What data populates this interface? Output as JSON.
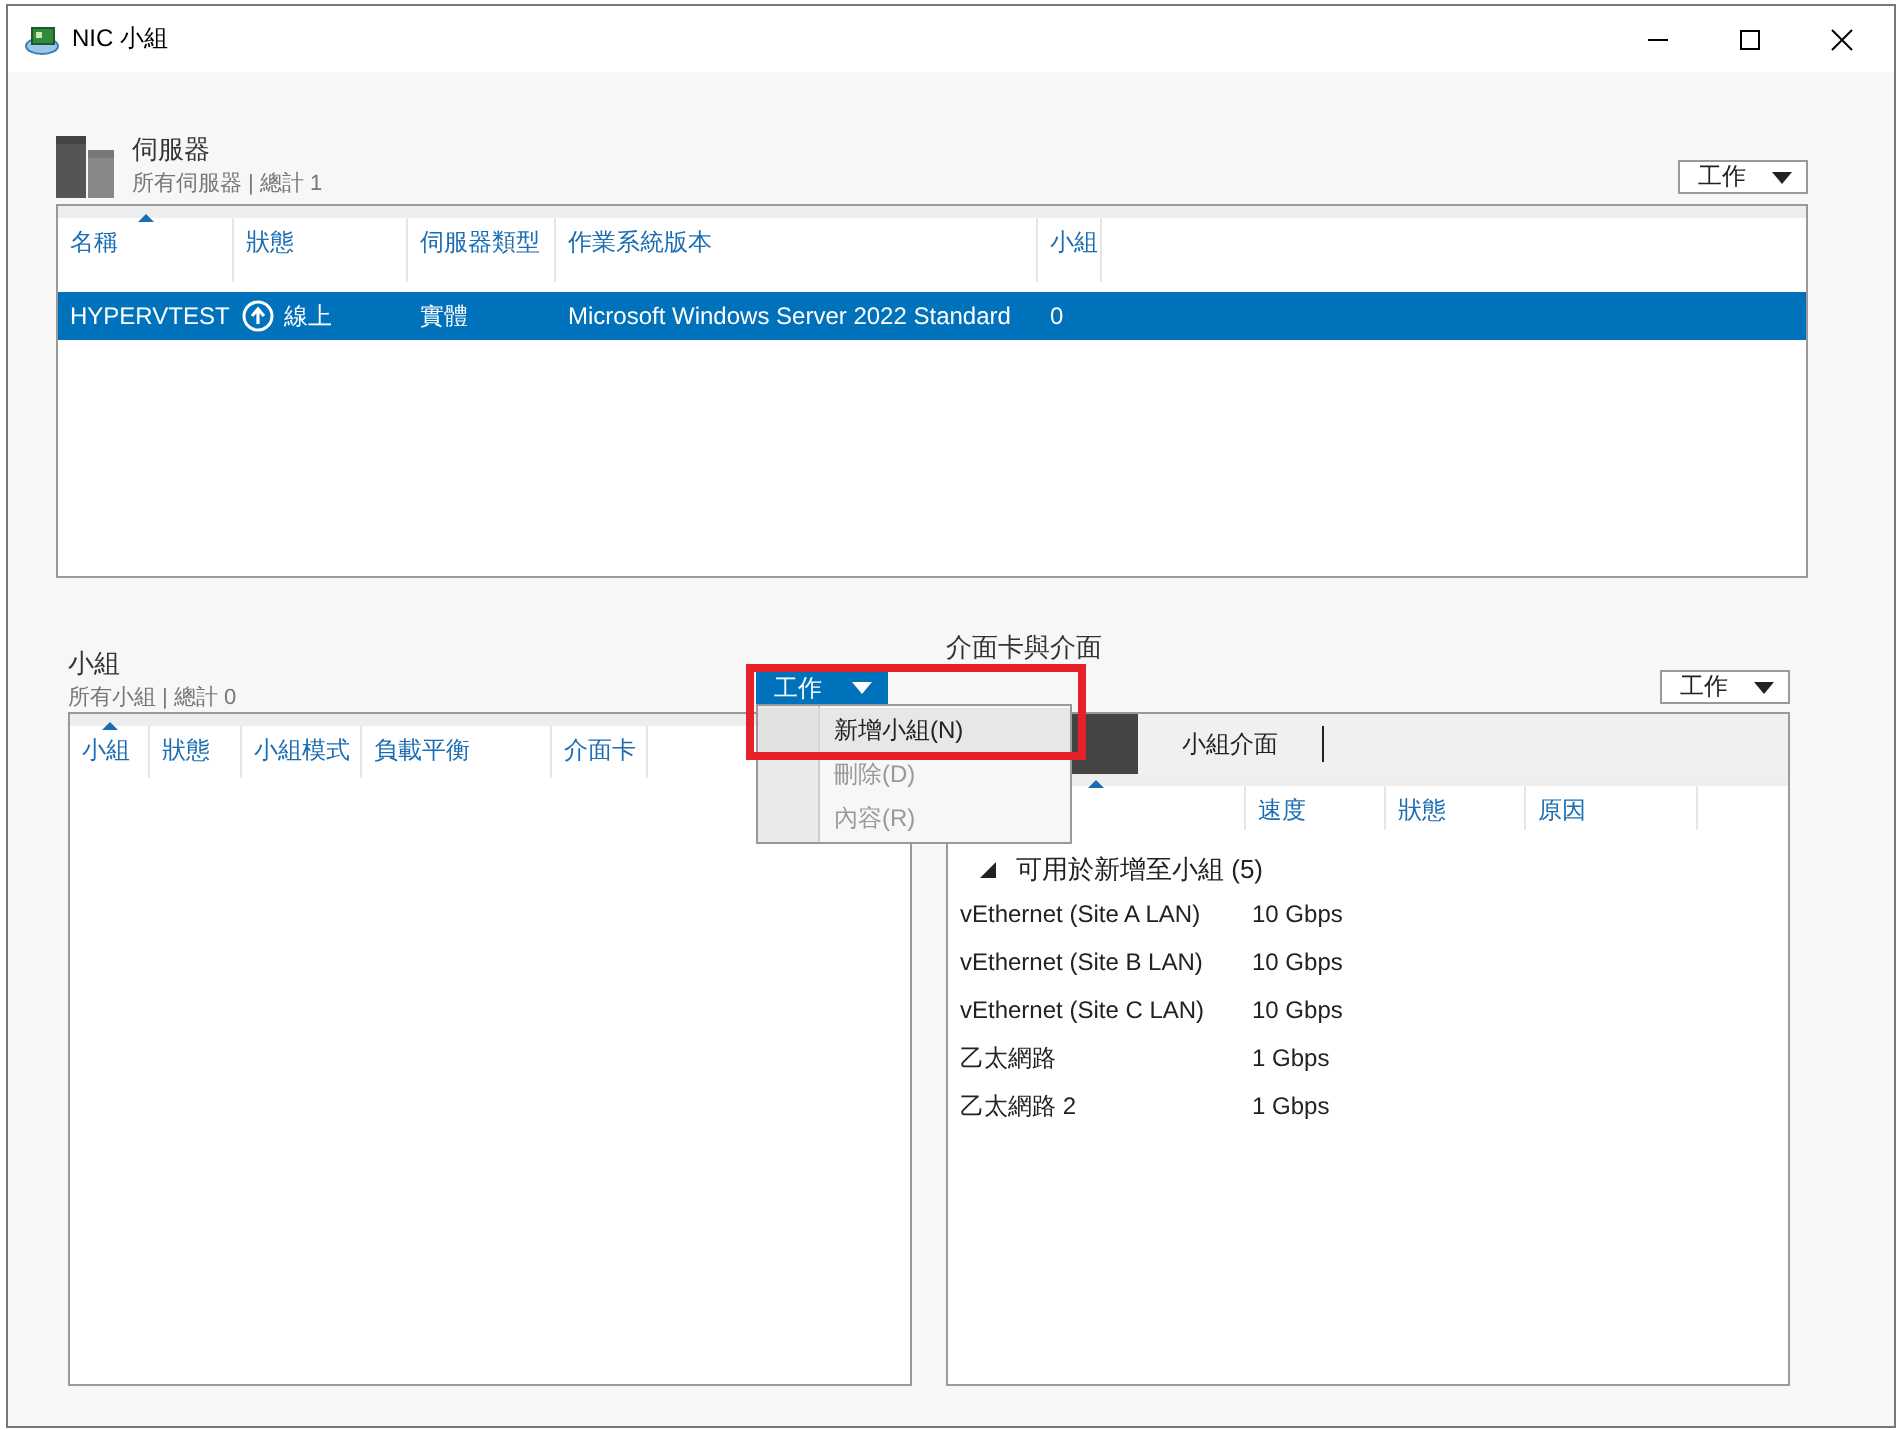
{
  "window": {
    "title": "NIC 小組"
  },
  "servers": {
    "title": "伺服器",
    "subtitle": "所有伺服器 | 總計 1",
    "tasks_button": "工作",
    "columns": [
      {
        "label": "名稱",
        "sorted": true
      },
      {
        "label": "狀態",
        "sorted": false
      },
      {
        "label": "伺服器類型",
        "sorted": false
      },
      {
        "label": "作業系統版本",
        "sorted": false
      },
      {
        "label": "小組",
        "sorted": false
      }
    ],
    "rows": [
      {
        "name": "HYPERVTEST",
        "status": "線上",
        "type": "實體",
        "os": "Microsoft Windows Server 2022 Standard",
        "teams": "0",
        "selected": true
      }
    ]
  },
  "teams": {
    "title": "小組",
    "subtitle": "所有小組 | 總計 0",
    "columns": [
      {
        "label": "小組",
        "sorted": true
      },
      {
        "label": "狀態",
        "sorted": false
      },
      {
        "label": "小組模式",
        "sorted": false
      },
      {
        "label": "負載平衡",
        "sorted": false
      },
      {
        "label": "介面卡",
        "sorted": false
      }
    ]
  },
  "tasks_menu": {
    "button": "工作",
    "items": [
      {
        "label": "新增小組(N)",
        "disabled": false,
        "highlighted": true
      },
      {
        "label": "刪除(D)",
        "disabled": true,
        "highlighted": false
      },
      {
        "label": "內容(R)",
        "disabled": true,
        "highlighted": false
      }
    ]
  },
  "adapters": {
    "title": "介面卡與介面",
    "tasks_button": "工作",
    "tabs": [
      {
        "selected": true
      },
      {
        "label": "小組介面",
        "selected": false
      }
    ],
    "columns": [
      {
        "sorted": true
      },
      {
        "label": "速度",
        "sorted": false
      },
      {
        "label": "狀態",
        "sorted": false
      },
      {
        "label": "原因",
        "sorted": false
      }
    ],
    "groups": [
      {
        "label": "可用於新增至小組 (5)",
        "expanded": true,
        "children": [
          {
            "name": "vEthernet (Site A LAN)",
            "speed": "10 Gbps"
          },
          {
            "name": "vEthernet (Site B LAN)",
            "speed": "10 Gbps"
          },
          {
            "name": "vEthernet (Site C LAN)",
            "speed": "10 Gbps"
          },
          {
            "name": "乙太網路",
            "speed": "1 Gbps"
          },
          {
            "name": "乙太網路 2",
            "speed": "1 Gbps"
          }
        ]
      }
    ]
  }
}
